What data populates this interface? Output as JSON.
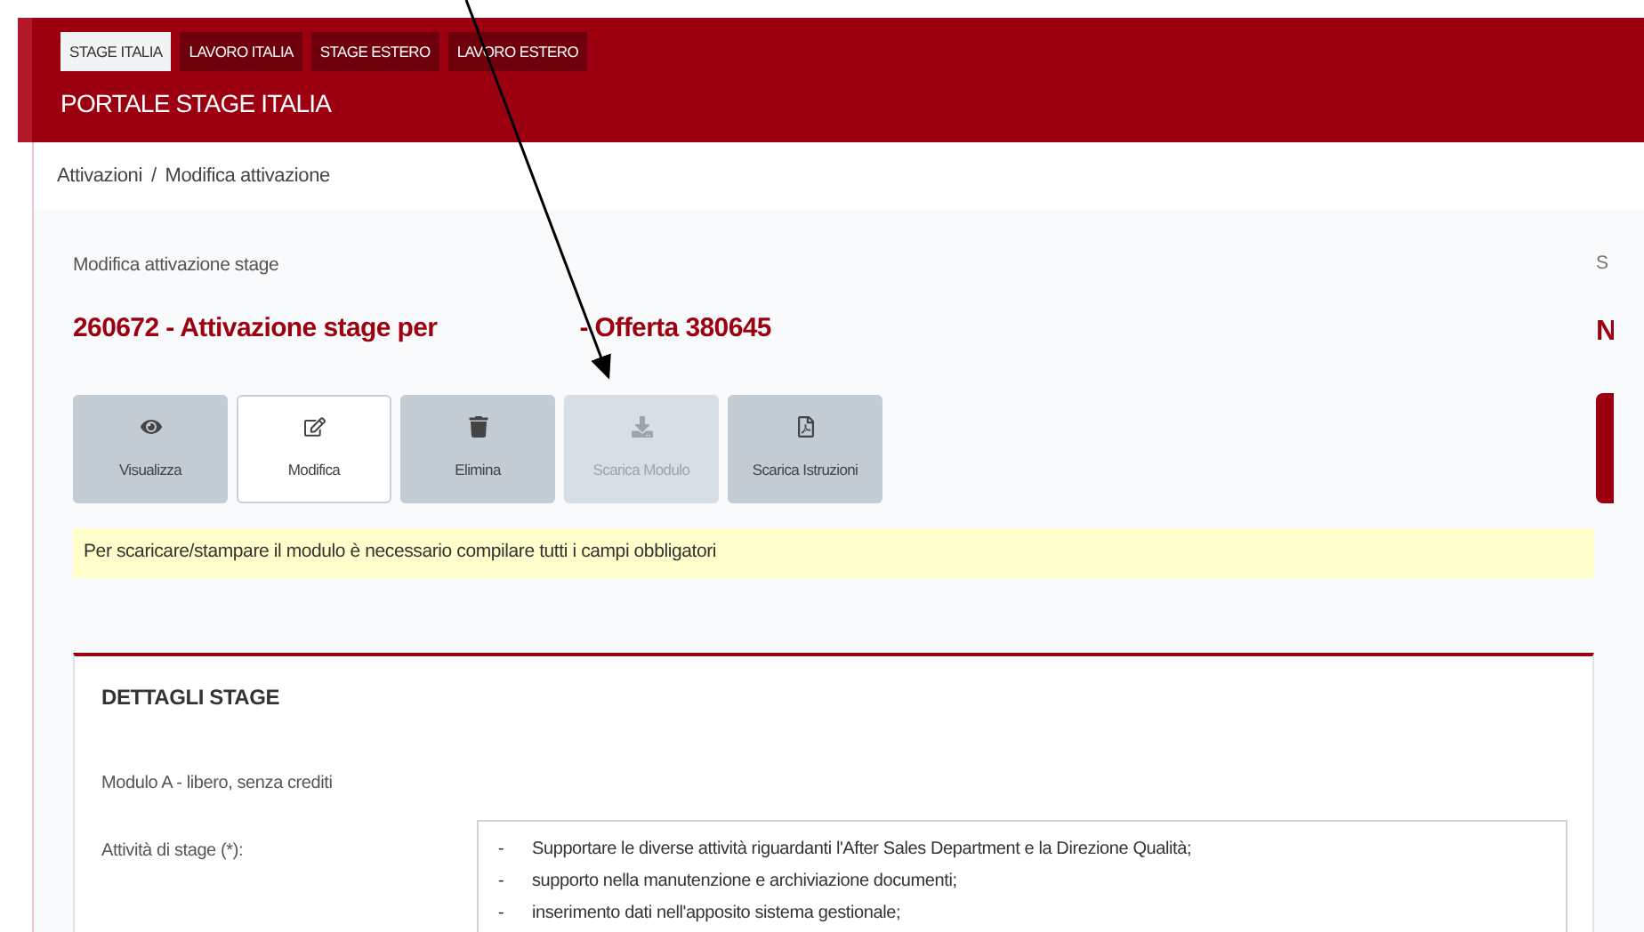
{
  "header": {
    "tabs": [
      {
        "label": "STAGE ITALIA",
        "selected": true
      },
      {
        "label": "LAVORO ITALIA",
        "selected": false
      },
      {
        "label": "STAGE ESTERO",
        "selected": false
      },
      {
        "label": "LAVORO ESTERO",
        "selected": false
      }
    ],
    "title": "PORTALE STAGE ITALIA"
  },
  "breadcrumb": [
    {
      "label": "Attivazioni"
    },
    {
      "label": "Modifica attivazione"
    }
  ],
  "breadcrumb_separator": "/",
  "page": {
    "subtitle": "Modifica attivazione stage",
    "title_start": "260672 - Attivazione stage per",
    "title_end": "- Offerta 380645"
  },
  "actions": [
    {
      "label": "Visualizza",
      "selected": false,
      "disabled": false
    },
    {
      "label": "Modifica",
      "selected": true,
      "disabled": false
    },
    {
      "label": "Elimina",
      "selected": false,
      "disabled": false
    },
    {
      "label": "Scarica Modulo",
      "selected": false,
      "disabled": true
    },
    {
      "label": "Scarica Istruzioni",
      "selected": false,
      "disabled": false
    }
  ],
  "notice": "Per scaricare/stampare il modulo è necessario compilare tutti i campi obbligatori",
  "details": {
    "title": "DETTAGLI STAGE",
    "module": "Modulo A - libero, senza crediti",
    "field_label": "Attività di stage (*):",
    "lines": [
      {
        "marker": "-",
        "text": "Supportare le diverse attività riguardanti l'After Sales Department e la Direzione Qualità;"
      },
      {
        "marker": "-",
        "text": "supporto nella manutenzione e archiviazione documenti;"
      },
      {
        "marker": "-",
        "text": "inserimento dati nell'apposito sistema gestionale;"
      }
    ]
  },
  "side": {
    "label": "S",
    "value": "N"
  }
}
